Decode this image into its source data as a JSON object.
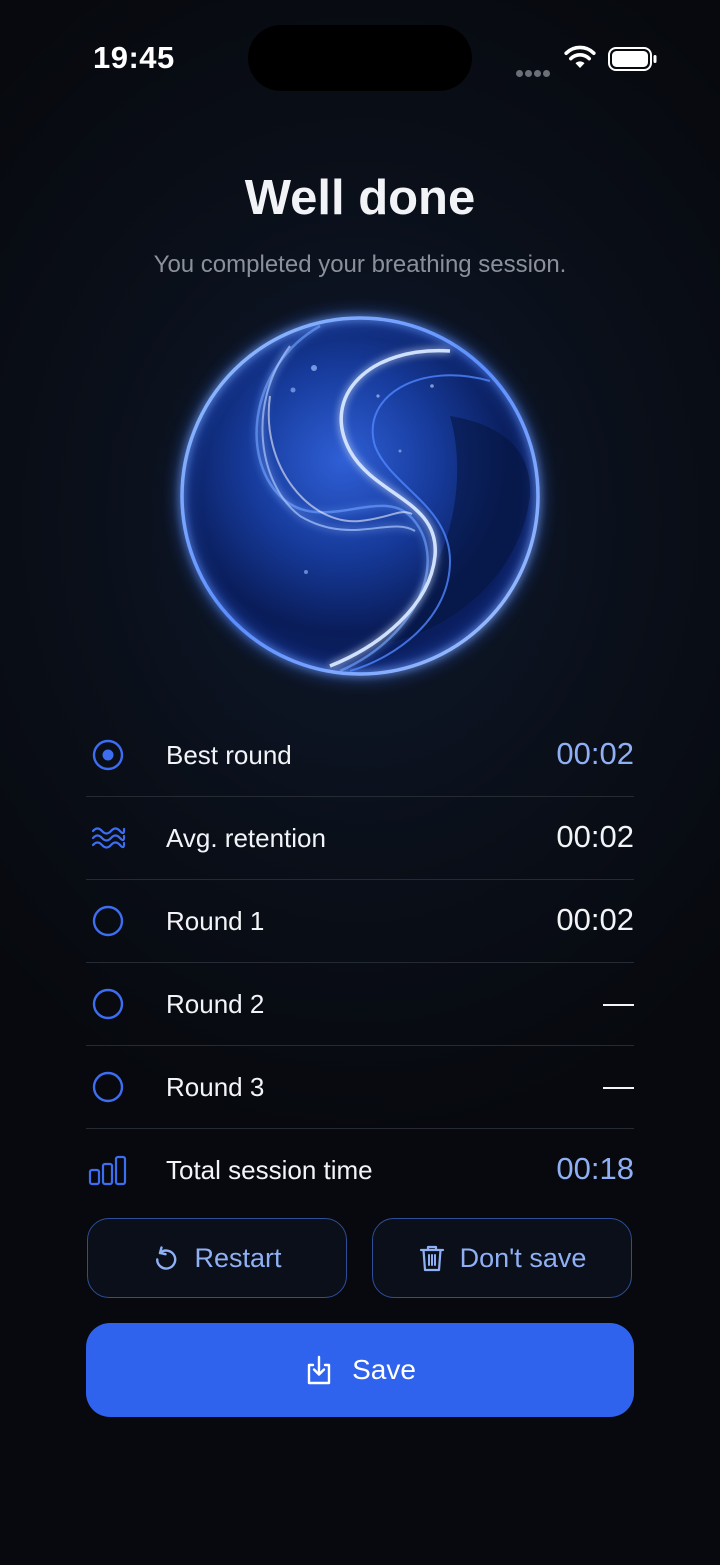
{
  "status_bar": {
    "time": "19:45"
  },
  "header": {
    "title": "Well done",
    "subtitle": "You completed your breathing session."
  },
  "stats": [
    {
      "icon": "target-icon",
      "label": "Best round",
      "value": "00:02",
      "highlight": true
    },
    {
      "icon": "waves-icon",
      "label": "Avg. retention",
      "value": "00:02",
      "highlight": false
    },
    {
      "icon": "circle-icon",
      "label": "Round 1",
      "value": "00:02",
      "highlight": false
    },
    {
      "icon": "circle-icon",
      "label": "Round 2",
      "value": "—",
      "highlight": false
    },
    {
      "icon": "circle-icon",
      "label": "Round 3",
      "value": "—",
      "highlight": false
    },
    {
      "icon": "bar-chart-icon",
      "label": "Total session time",
      "value": "00:18",
      "highlight": true
    }
  ],
  "actions": {
    "restart_label": "Restart",
    "dont_save_label": "Don't save",
    "save_label": "Save"
  },
  "colors": {
    "accent": "#2f62ed",
    "accent_text": "#8fb0f5",
    "icon_blue": "#3d6df0",
    "background": "#07090e"
  }
}
